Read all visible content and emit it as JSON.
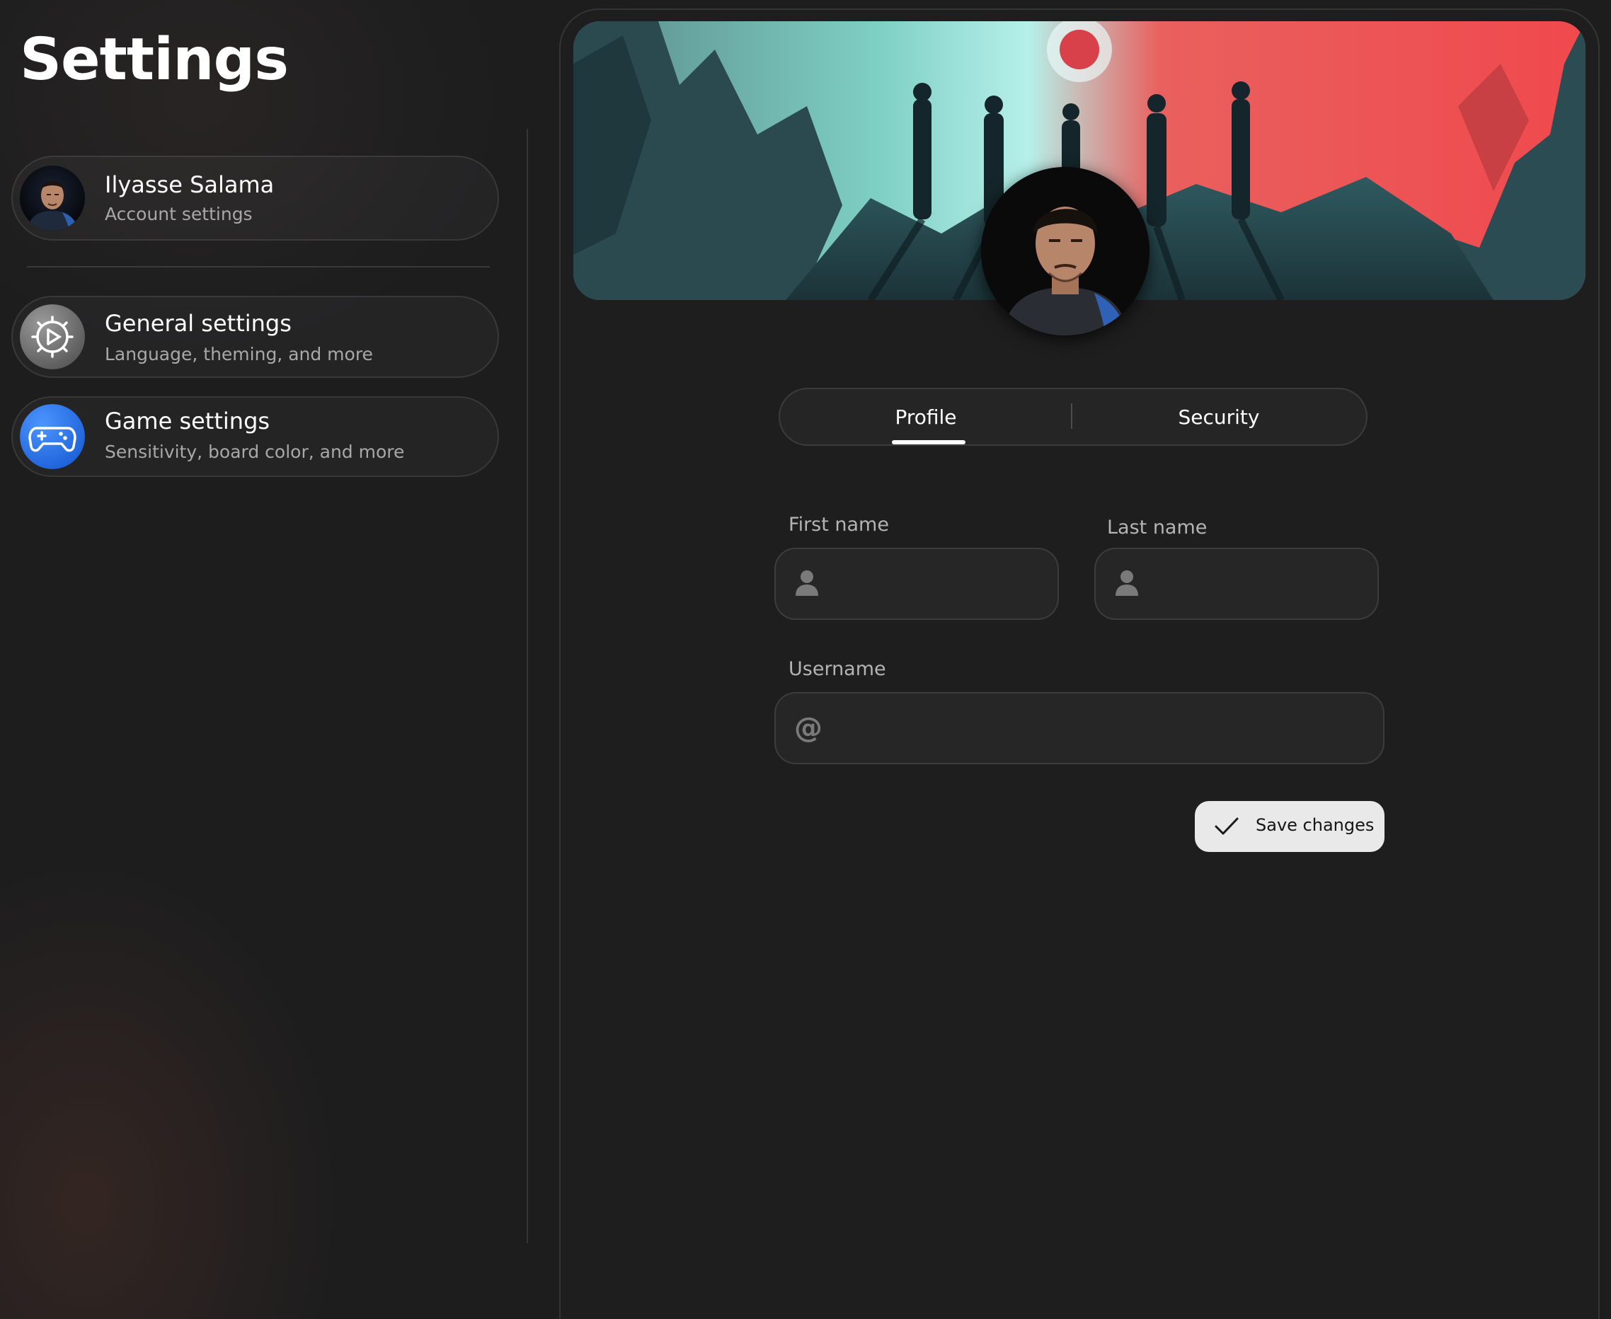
{
  "page": {
    "title": "Settings"
  },
  "sidebar": {
    "account": {
      "name": "Ilyasse Salama",
      "subtitle": "Account settings",
      "icon": "user-avatar"
    },
    "items": [
      {
        "label": "General settings",
        "subtitle": "Language, theming, and more",
        "icon": "gear-icon",
        "color": "#6e6e6e"
      },
      {
        "label": "Game settings",
        "subtitle": "Sensitivity, board color, and more",
        "icon": "gamepad-icon",
        "color": "#2f7bf2"
      }
    ]
  },
  "profile": {
    "banner": "game-artwork-banner",
    "avatar": "user-avatar"
  },
  "tabs": [
    {
      "label": "Profile",
      "active": true
    },
    {
      "label": "Security",
      "active": false
    }
  ],
  "form": {
    "first_name": {
      "label": "First name",
      "value": "",
      "placeholder": "",
      "icon": "person-icon"
    },
    "last_name": {
      "label": "Last name",
      "value": "",
      "placeholder": "",
      "icon": "person-icon"
    },
    "username": {
      "label": "Username",
      "value": "",
      "placeholder": "",
      "icon": "at-icon"
    },
    "save_label": "Save changes"
  }
}
